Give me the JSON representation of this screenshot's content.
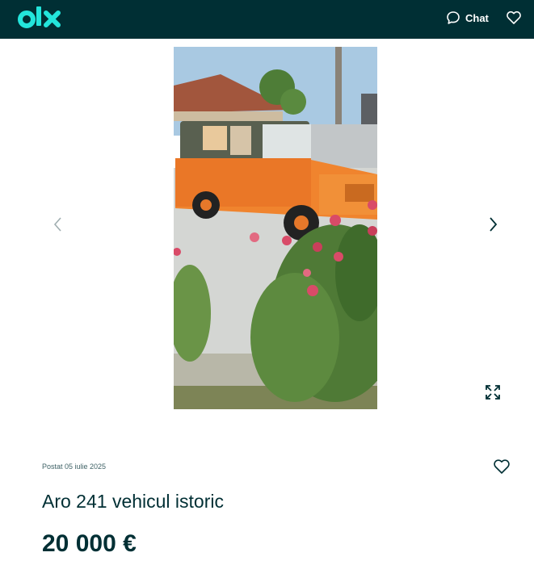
{
  "header": {
    "logo_text": "olx",
    "chat_label": "Chat"
  },
  "icons": {
    "chat": "chat-bubble-icon",
    "favorite": "heart-outline-icon",
    "prev": "chevron-left-icon",
    "next": "chevron-right-icon",
    "expand": "fullscreen-expand-icon"
  },
  "ad": {
    "posted": "Postat 05 iulie 2025",
    "title": "Aro 241 vehicul istoric",
    "price": "20 000 €"
  },
  "colors": {
    "header_bg": "#002f34",
    "logo": "#23e5db",
    "text": "#002f34"
  }
}
